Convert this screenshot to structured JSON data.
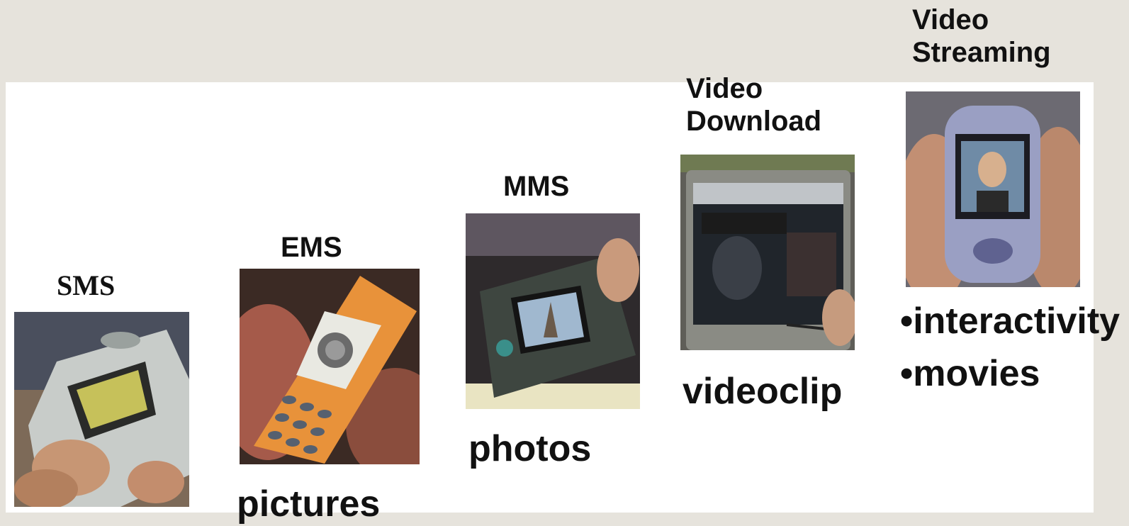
{
  "services": [
    {
      "title": "SMS",
      "caption": "",
      "image_icon": "mobile-phone-sms-icon"
    },
    {
      "title": "EMS",
      "caption": "pictures",
      "image_icon": "mobile-phone-ems-icon"
    },
    {
      "title": "MMS",
      "caption": "photos",
      "image_icon": "camera-phone-icon"
    },
    {
      "title_line1": "Video",
      "title_line2": "Download",
      "caption": "videoclip",
      "image_icon": "pda-video-icon"
    },
    {
      "title_line1": "Video",
      "title_line2": "Streaming",
      "bullets": [
        "•interactivity",
        "•movies"
      ],
      "image_icon": "video-phone-icon"
    }
  ],
  "colors": {
    "background": "#e6e3dc",
    "panel": "#ffffff",
    "text": "#111111"
  }
}
